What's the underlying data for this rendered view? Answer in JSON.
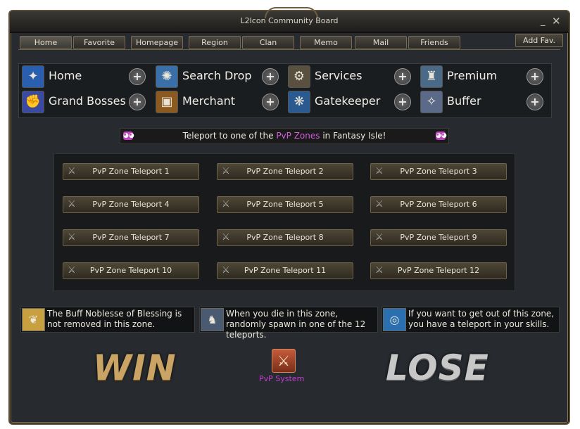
{
  "window": {
    "title": "L2Icon Community Board",
    "minimize": "_",
    "close": "✕"
  },
  "tabs": [
    "Home",
    "Favorite",
    "Homepage",
    "Region",
    "Clan",
    "Memo",
    "Mail",
    "Friends"
  ],
  "add_fav": "Add Fav.",
  "nav": [
    {
      "label": "Home",
      "icon": "home-icon",
      "glyph": "✦",
      "color": "#2a5fb0"
    },
    {
      "label": "Search Drop",
      "icon": "search-drop-icon",
      "glyph": "✺",
      "color": "#3a6fa8"
    },
    {
      "label": "Services",
      "icon": "services-gear-icon",
      "glyph": "⚙",
      "color": "#5a5040"
    },
    {
      "label": "Premium",
      "icon": "premium-icon",
      "glyph": "♜",
      "color": "#4a6a88"
    },
    {
      "label": "Grand Bosses",
      "icon": "grand-bosses-icon",
      "glyph": "✊",
      "color": "#3a4aa0"
    },
    {
      "label": "Merchant",
      "icon": "merchant-chest-icon",
      "glyph": "▣",
      "color": "#8a5a20"
    },
    {
      "label": "Gatekeeper",
      "icon": "gatekeeper-icon",
      "glyph": "❋",
      "color": "#2a5a90"
    },
    {
      "label": "Buffer",
      "icon": "buffer-icon",
      "glyph": "✧",
      "color": "#5a6a88"
    }
  ],
  "banner": {
    "prefix": "Teleport to one of the ",
    "highlight": "PvP Zones",
    "suffix": " in Fantasy Isle!",
    "icon": "pvp-mask-icon"
  },
  "teleports": [
    "PvP Zone Teleport 1",
    "PvP Zone Teleport 2",
    "PvP Zone Teleport 3",
    "PvP Zone Teleport 4",
    "PvP Zone Teleport 5",
    "PvP Zone Teleport 6",
    "PvP Zone Teleport 7",
    "PvP Zone Teleport 8",
    "PvP Zone Teleport 9",
    "PvP Zone Teleport 10",
    "PvP Zone Teleport 11",
    "PvP Zone Teleport 12"
  ],
  "info": [
    {
      "text": "The Buff Noblesse of Blessing is not removed in this zone.",
      "icon": "noblesse-blessing-icon",
      "glyph": "❦",
      "color": "#c8a040"
    },
    {
      "text": "When you die in this zone, randomly spawn in one of the 12 teleports.",
      "icon": "spawn-knight-icon",
      "glyph": "♞",
      "color": "#4a5a70"
    },
    {
      "text": "If you want to get out of this zone, you have a teleport in your skills.",
      "icon": "teleport-vortex-icon",
      "glyph": "◎",
      "color": "#2a70b0"
    }
  ],
  "footer": {
    "win": "WIN",
    "lose": "LOSE",
    "pvp_label": "PvP System"
  }
}
